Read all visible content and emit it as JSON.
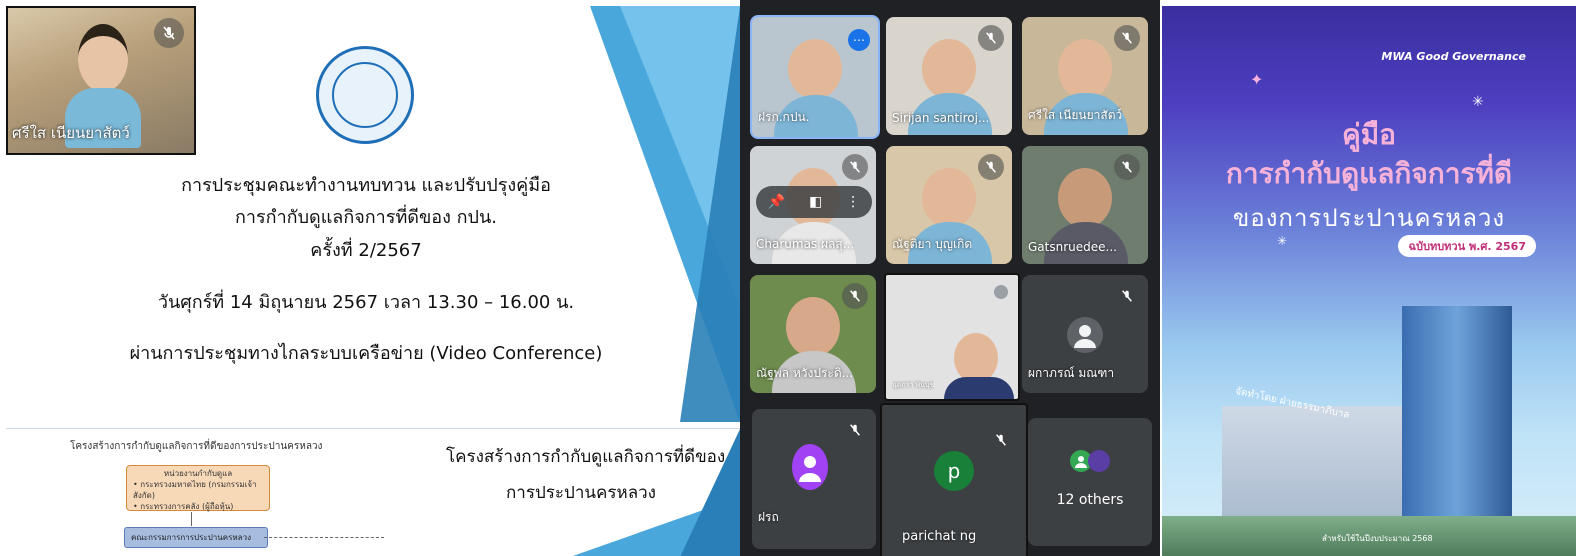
{
  "slide_top": {
    "pip_name": "ศรีใส เนียนยาสัตว์",
    "line1": "การประชุมคณะทำงานทบทวน และปรับปรุงคู่มือ",
    "line2": "การกำกับดูแลกิจการที่ดีของ กปน.",
    "line3": "ครั้งที่ 2/2567",
    "date_line": "วันศุกร์ที่ 14 มิถุนายน 2567  เวลา 13.30 – 16.00 น.",
    "venue_line": "ผ่านการประชุมทางไกลระบบเครือข่าย (Video Conference)"
  },
  "slide_bottom": {
    "chart_title": "โครงสร้างการกำกับดูแลกิจการที่ดีของการประปานครหลวง",
    "box1_title": "หน่วยงานกำกับดูแล",
    "box1_item1": "• กระทรวงมหาดไทย (กรมกรรมเจ้าสังกัด)",
    "box1_item2": "• กระทรวงการคลัง (ผู้ถือหุ้น)",
    "box2": "คณะกรรมการการประปานครหลวง",
    "heading1": "โครงสร้างการกำกับดูแลกิจการที่ดีของ",
    "heading2": "การประปานครหลวง"
  },
  "meet": {
    "tiles": [
      {
        "name": "ฝรก.กปน.",
        "shirt": "#7db5d6",
        "bg": "#b9c5cf"
      },
      {
        "name": "Sirijan santiroj...",
        "shirt": "#7db5d6",
        "bg": "#d9d4cc"
      },
      {
        "name": "ศรีใส เนียนยาสัตว์",
        "shirt": "#7db5d6",
        "bg": "#c9b79a"
      },
      {
        "name": "Charumas ผลสุ...",
        "shirt": "#e8e8e8",
        "bg": "#cfd3d6"
      },
      {
        "name": "ณัฐติยา บุญเกิด",
        "shirt": "#7db5d6",
        "bg": "#d8c7a8"
      },
      {
        "name": "Gatsnruedee...",
        "shirt": "#5a5a66",
        "bg": "#6f7d6f"
      },
      {
        "name": "ณัฐพล หวังประดิ...",
        "shirt": "#c7c7c7",
        "bg": "#6e8c4e"
      },
      {
        "name": "นุดกรา พินนุช",
        "shirt": "#2b3b6f",
        "bg": "#e2e2e2"
      }
    ],
    "avatar_tiles": [
      {
        "name": "ผกาภรณ์ มณฑา",
        "color": "#f1f3f4"
      },
      {
        "name": "ฝรถ",
        "color": "#a142f4"
      },
      {
        "name": "parichat ng",
        "letter": "p",
        "color": "#188038"
      },
      {
        "name": "12 others"
      }
    ]
  },
  "cover": {
    "tagline": "MWA Good Governance",
    "title1": "คู่มือ",
    "title2": "การกำกับดูแลกิจการที่ดี",
    "title3": "ของการประปานครหลวง",
    "edition": "ฉบับทบทวน พ.ศ. 2567",
    "by_line": "จัดทำโดย ฝ่ายธรรมาภิบาล",
    "footer": "สำหรับใช้ในปีงบประมาณ 2568"
  },
  "colors": {
    "meet_bg": "#202124",
    "tile_bg": "#3c4043",
    "slide_blue": "#4aa7db",
    "cover_title": "#f7b2d9"
  }
}
